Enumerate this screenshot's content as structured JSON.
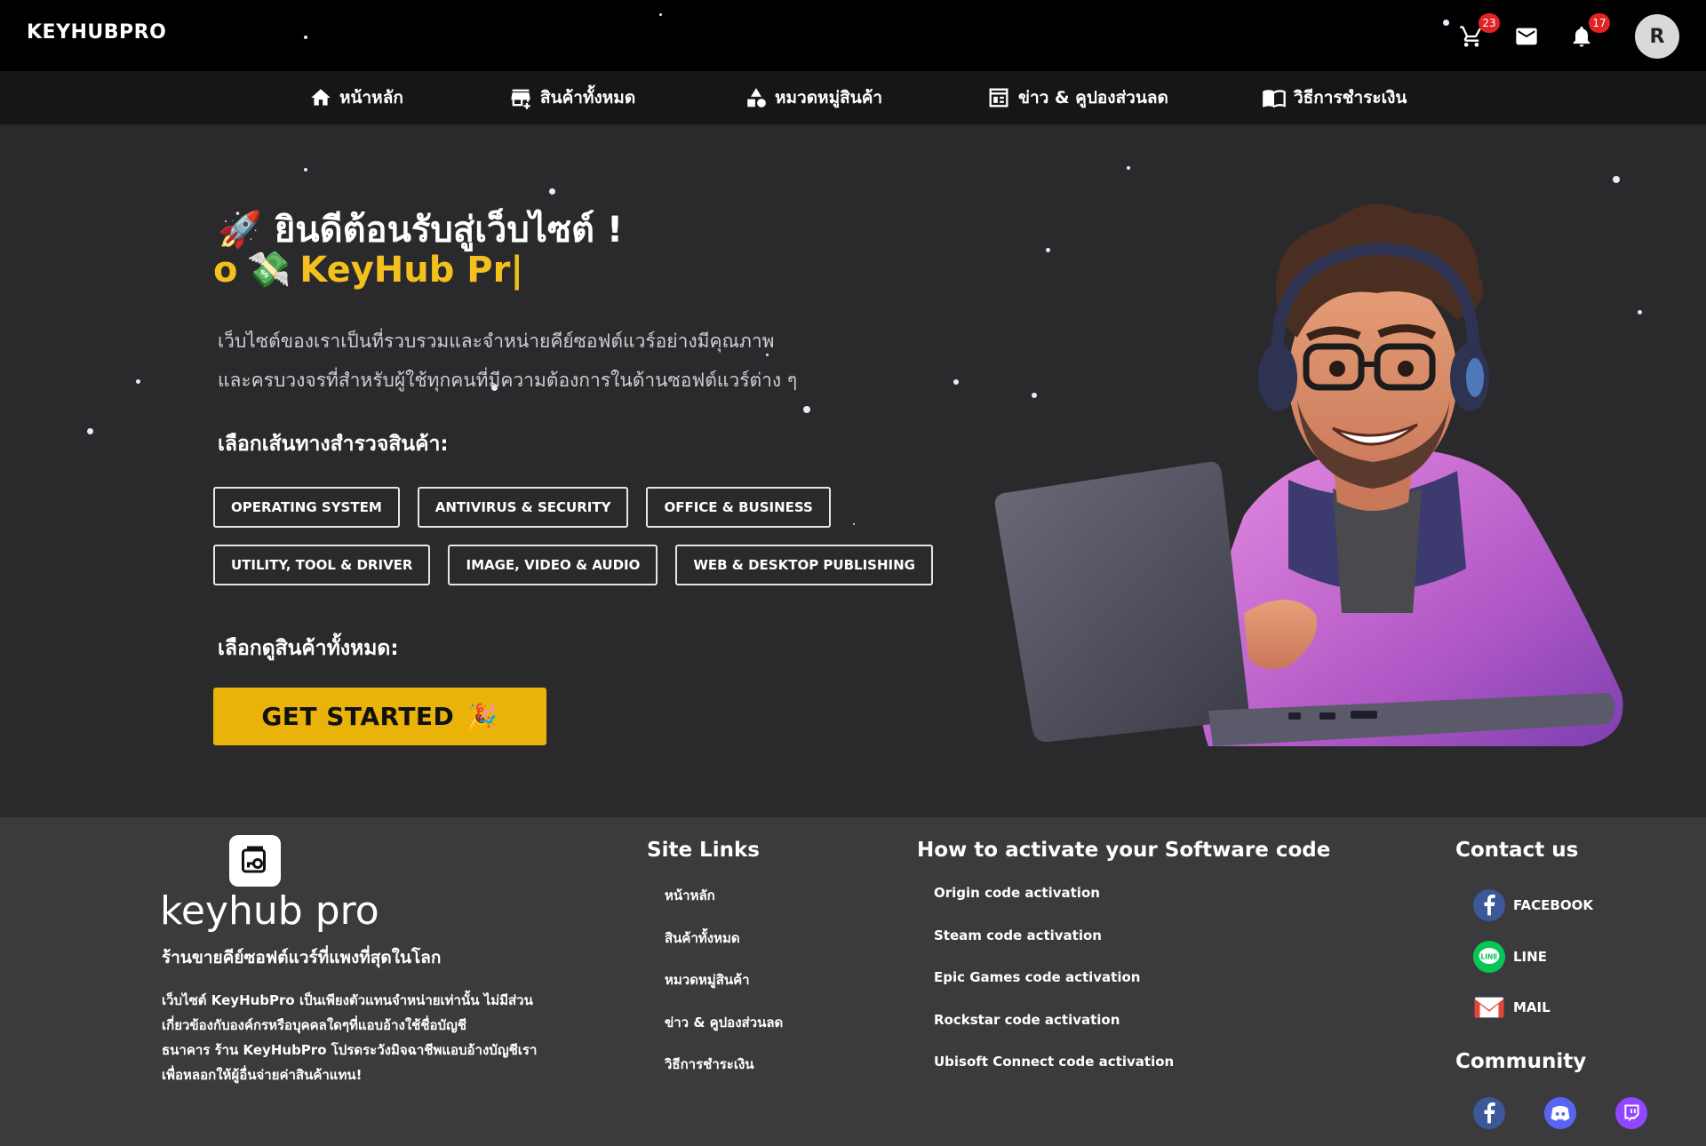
{
  "topbar": {
    "brand": "KEYHUBPRO",
    "cart_count": "23",
    "notification_count": "17",
    "avatar_initial": "R"
  },
  "nav": {
    "items": [
      {
        "label": "หน้าหลัก",
        "icon": "home-icon"
      },
      {
        "label": "สินค้าทั้งหมด",
        "icon": "store-icon"
      },
      {
        "label": "หมวดหมู่สินค้า",
        "icon": "category-icon"
      },
      {
        "label": "ข่าว & คูปองส่วนลด",
        "icon": "news-icon"
      },
      {
        "label": "วิธีการชำระเงิน",
        "icon": "book-icon"
      }
    ]
  },
  "hero": {
    "title_emoji": "🚀",
    "title": "ยินดีต้อนรับสู่เว็บไซต์ !",
    "typing_prefix": "o",
    "typing_emoji": "💸",
    "typing_text": "KeyHub Pr|",
    "description_line1": "เว็บไซต์ของเราเป็นที่รวบรวมและจำหน่ายคีย์ซอฟต์แวร์อย่างมีคุณภาพ",
    "description_line2": "และครบวงจรที่สำหรับผู้ใช้ทุกคนที่มีความต้องการในด้านซอฟต์แวร์ต่าง ๆ",
    "browse_heading": "เลือกเส้นทางสำรวจสินค้า:",
    "categories_row1": [
      "OPERATING SYSTEM",
      "ANTIVIRUS & SECURITY",
      "OFFICE & BUSINESS"
    ],
    "categories_row2": [
      "UTILITY, TOOL & DRIVER",
      "IMAGE, VIDEO & AUDIO",
      "WEB & DESKTOP PUBLISHING"
    ],
    "all_heading": "เลือกดูสินค้าทั้งหมด:",
    "cta_label": "GET STARTED",
    "cta_emoji": "🎉"
  },
  "footer": {
    "brand": "keyhub pro",
    "tagline": "ร้านขายคีย์ซอฟต์แวร์ที่แพงที่สุดในโลก",
    "disclaimer_line1": "เว็บไซต์ KeyHubPro เป็นเพียงตัวแทนจำหน่ายเท่านั้น ไม่มีส่วน",
    "disclaimer_line2": "เกี่ยวข้องกับองค์กรหรือบุคคลใดๆที่แอบอ้างใช้ชื่อบัญชี",
    "disclaimer_line3": "ธนาคาร ร้าน KeyHubPro โปรดระวังมิจฉาชีพแอบอ้างบัญชีเรา",
    "disclaimer_line4": "เพื่อหลอกให้ผู้อื่นจ่ายค่าสินค้าแทน!",
    "site_links_heading": "Site Links",
    "site_links": [
      "หน้าหลัก",
      "สินค้าทั้งหมด",
      "หมวดหมู่สินค้า",
      "ข่าว & คูปองส่วนลด",
      "วิธีการชำระเงิน"
    ],
    "activate_heading": "How to activate your Software code",
    "activate_links": [
      "Origin code activation",
      "Steam code activation",
      "Epic Games code activation",
      "Rockstar code activation",
      "Ubisoft Connect code activation"
    ],
    "contact_heading": "Contact us",
    "contacts": [
      {
        "label": "FACEBOOK",
        "icon": "facebook-icon",
        "color": "#3b5998"
      },
      {
        "label": "LINE",
        "icon": "line-icon",
        "color": "#06c755"
      },
      {
        "label": "MAIL",
        "icon": "gmail-icon",
        "color": "#ea4335"
      }
    ],
    "community_heading": "Community",
    "community": [
      {
        "icon": "facebook-icon",
        "color": "#3b5998"
      },
      {
        "icon": "discord-icon",
        "color": "#5865f2"
      },
      {
        "icon": "twitch-icon",
        "color": "#9146ff"
      }
    ]
  },
  "colors": {
    "accent": "#eab309",
    "typing_text": "#f4c01e",
    "badge": "#e02424",
    "hero_bg": "#2a2a2c",
    "footer_bg": "#3b3b3e"
  }
}
